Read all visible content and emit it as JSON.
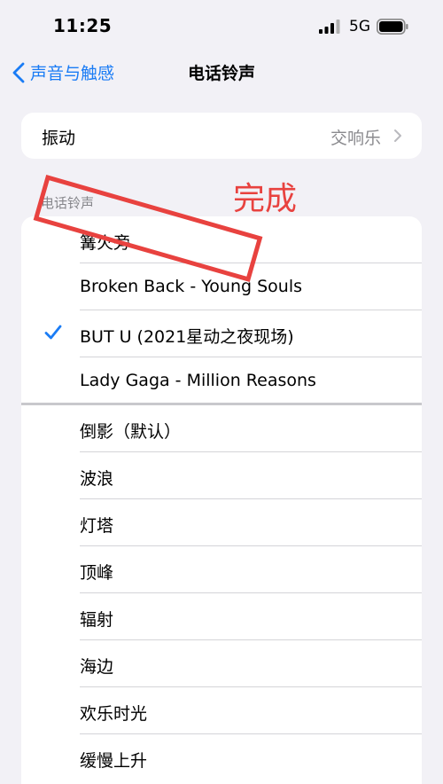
{
  "status": {
    "time": "11:25",
    "network": "5G"
  },
  "nav": {
    "back_label": "声音与触感",
    "title": "电话铃声"
  },
  "vibration": {
    "label": "振动",
    "value": "交响乐"
  },
  "ringtones": {
    "section_title": "电话铃声",
    "items": [
      {
        "label": "篝火旁",
        "checked": false
      },
      {
        "label": "Broken Back - Young Souls",
        "checked": false
      },
      {
        "label": "BUT U (2021星动之夜现场)",
        "checked": true
      },
      {
        "label": "Lady Gaga - Million Reasons",
        "checked": false
      },
      {
        "label": "倒影（默认）",
        "checked": false
      },
      {
        "label": "波浪",
        "checked": false
      },
      {
        "label": "灯塔",
        "checked": false
      },
      {
        "label": "顶峰",
        "checked": false
      },
      {
        "label": "辐射",
        "checked": false
      },
      {
        "label": "海边",
        "checked": false
      },
      {
        "label": "欢乐时光",
        "checked": false
      },
      {
        "label": "缓慢上升",
        "checked": false
      }
    ]
  },
  "annotation": {
    "text": "完成"
  },
  "colors": {
    "accent": "#1a7cf5",
    "annotation": "#e8423f",
    "background": "#f2f1f6"
  }
}
